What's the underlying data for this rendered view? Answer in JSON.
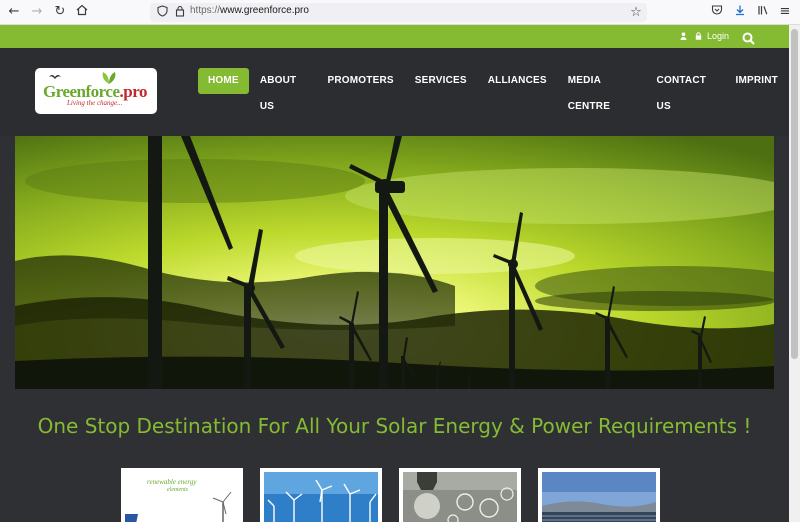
{
  "browser": {
    "url_protocol": "https://",
    "url_domain": "www.greenforce.pro",
    "icons": [
      "back-icon",
      "forward-icon",
      "reload-icon",
      "home-icon",
      "shield-icon",
      "lock-icon",
      "bookmark-star-icon",
      "pocket-icon",
      "download-icon",
      "library-icon",
      "menu-icon"
    ]
  },
  "topbar": {
    "login_label": "Login"
  },
  "logo": {
    "name_main": "Greenforce",
    "name_suffix": ".pro",
    "tagline": "Living the change..."
  },
  "menu": {
    "items": [
      {
        "label": "HOME",
        "active": true
      },
      {
        "label": "ABOUT US",
        "active": false
      },
      {
        "label": "PROMOTERS",
        "active": false
      },
      {
        "label": "SERVICES",
        "active": false
      },
      {
        "label": "ALLIANCES",
        "active": false
      },
      {
        "label": "MEDIA CENTRE",
        "active": false
      },
      {
        "label": "CONTACT US",
        "active": false
      },
      {
        "label": "IMPRINT",
        "active": false
      }
    ]
  },
  "main": {
    "tagline": "One Stop Destination For All Your Solar Energy & Power Requirements !",
    "thumbnails": [
      {
        "caption_line1": "renewable energy",
        "caption_line2": "elements"
      },
      {
        "caption_line1": "",
        "caption_line2": ""
      },
      {
        "caption_line1": "",
        "caption_line2": ""
      },
      {
        "caption_line1": "",
        "caption_line2": ""
      }
    ]
  },
  "colors": {
    "accent": "#85bb33",
    "header_bg": "#2b2d30",
    "page_bg": "#2e3033"
  }
}
